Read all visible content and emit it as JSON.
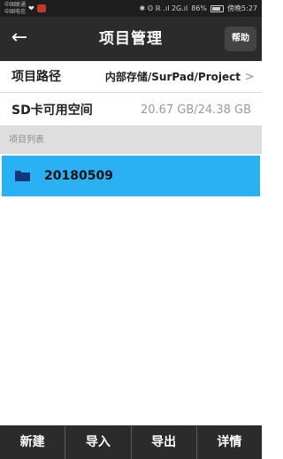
{
  "statusbar": {
    "carrier_line1": "中国联通",
    "carrier_line2": "中国电信",
    "icons_text": "✱ Ꙩ ℝ .ıl 2G.ıl",
    "battery_percent": "86%",
    "time_label": "傍晚5:27"
  },
  "toolbar": {
    "title": "项目管理",
    "help_label": "帮助"
  },
  "info": {
    "path_label": "项目路径",
    "path_value": "内部存储/SurPad/Project",
    "sd_label": "SD卡可用空间",
    "sd_value": "20.67 GB/24.38 GB"
  },
  "list": {
    "section_label": "项目列表",
    "items": [
      {
        "name": "20180509"
      }
    ]
  },
  "bottom": {
    "new_label": "新建",
    "import_label": "导入",
    "export_label": "导出",
    "details_label": "详情"
  },
  "colors": {
    "accent": "#2ab1f3",
    "toolbar": "#2b2b2b",
    "folder": "#10357a"
  }
}
